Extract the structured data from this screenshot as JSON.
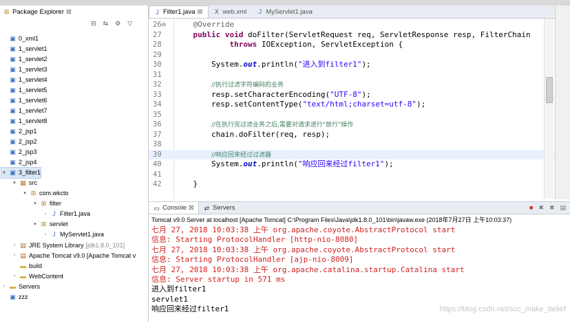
{
  "package_explorer": {
    "title": "Package Explorer",
    "close_glyph": "⊠",
    "tree": [
      {
        "label": "0_xml1",
        "icon": "project-icon",
        "indent": 0,
        "toggle": ""
      },
      {
        "label": "1_servlet1",
        "icon": "project-icon",
        "indent": 0,
        "toggle": ""
      },
      {
        "label": "1_servlet2",
        "icon": "project-icon",
        "indent": 0,
        "toggle": ""
      },
      {
        "label": "1_servlet3",
        "icon": "project-icon",
        "indent": 0,
        "toggle": ""
      },
      {
        "label": "1_servlet4",
        "icon": "project-icon",
        "indent": 0,
        "toggle": ""
      },
      {
        "label": "1_servlet5",
        "icon": "project-icon",
        "indent": 0,
        "toggle": ""
      },
      {
        "label": "1_servlet6",
        "icon": "project-icon",
        "indent": 0,
        "toggle": ""
      },
      {
        "label": "1_servlet7",
        "icon": "project-icon",
        "indent": 0,
        "toggle": ""
      },
      {
        "label": "1_servlet8",
        "icon": "project-icon",
        "indent": 0,
        "toggle": ""
      },
      {
        "label": "2_jsp1",
        "icon": "project-icon",
        "indent": 0,
        "toggle": ""
      },
      {
        "label": "2_jsp2",
        "icon": "project-icon",
        "indent": 0,
        "toggle": ""
      },
      {
        "label": "2_jsp3",
        "icon": "project-icon",
        "indent": 0,
        "toggle": ""
      },
      {
        "label": "2_jsp4",
        "icon": "project-icon",
        "indent": 0,
        "toggle": ""
      },
      {
        "label": "3_filter1",
        "icon": "web-project-icon",
        "indent": 0,
        "toggle": "▾",
        "selected": true
      },
      {
        "label": "src",
        "icon": "source-folder-icon",
        "indent": 1,
        "toggle": "▾"
      },
      {
        "label": "com.wkcto",
        "icon": "package-icon",
        "indent": 2,
        "toggle": "▾"
      },
      {
        "label": "filter",
        "icon": "package-icon",
        "indent": 3,
        "toggle": "▾"
      },
      {
        "label": "Filter1.java",
        "icon": "java-file-icon",
        "indent": 4,
        "toggle": "›"
      },
      {
        "label": "servlet",
        "icon": "package-icon",
        "indent": 3,
        "toggle": "▾"
      },
      {
        "label": "MyServlet1.java",
        "icon": "java-file-icon",
        "indent": 4,
        "toggle": "›"
      },
      {
        "label": "JRE System Library",
        "suffix": "[jdk1.8.0_101]",
        "icon": "library-icon",
        "indent": 1,
        "toggle": "›"
      },
      {
        "label": "Apache Tomcat v9.0 [Apache Tomcat v",
        "icon": "library-icon",
        "indent": 1,
        "toggle": "›"
      },
      {
        "label": "build",
        "icon": "folder-icon",
        "indent": 1,
        "toggle": ""
      },
      {
        "label": "WebContent",
        "icon": "folder-icon",
        "indent": 1,
        "toggle": "›"
      },
      {
        "label": "Servers",
        "icon": "folder-icon",
        "indent": 0,
        "toggle": "›"
      },
      {
        "label": "zzz",
        "icon": "project-icon",
        "indent": 0,
        "toggle": ""
      }
    ]
  },
  "editor": {
    "tabs": [
      {
        "label": "Filter1.java",
        "active": true,
        "close": "⊠",
        "icon": "java-file-icon"
      },
      {
        "label": "web.xml",
        "active": false,
        "close": "",
        "icon": "xml-file-icon"
      },
      {
        "label": "MyServlet1.java",
        "active": false,
        "close": "",
        "icon": "java-file-icon"
      }
    ],
    "lines": [
      {
        "n": "26",
        "marker": "⊖",
        "tokens": [
          {
            "t": "    "
          },
          {
            "t": "@Override",
            "c": "ann"
          }
        ]
      },
      {
        "n": "27",
        "marker": "",
        "tokens": [
          {
            "t": "    "
          },
          {
            "t": "public",
            "c": "kw"
          },
          {
            "t": " "
          },
          {
            "t": "void",
            "c": "kw"
          },
          {
            "t": " doFilter(ServletRequest req, ServletResponse resp, FilterChain"
          }
        ]
      },
      {
        "n": "28",
        "marker": "",
        "tokens": [
          {
            "t": "            "
          },
          {
            "t": "throws",
            "c": "kw"
          },
          {
            "t": " IOException, ServletException {"
          }
        ]
      },
      {
        "n": "29",
        "marker": "",
        "tokens": []
      },
      {
        "n": "30",
        "marker": "",
        "tokens": [
          {
            "t": "        System."
          },
          {
            "t": "out",
            "c": "fld"
          },
          {
            "t": ".println("
          },
          {
            "t": "\"进入到filter1\"",
            "c": "str"
          },
          {
            "t": ");"
          }
        ]
      },
      {
        "n": "31",
        "marker": "",
        "tokens": []
      },
      {
        "n": "32",
        "marker": "",
        "tokens": [
          {
            "t": "        "
          },
          {
            "t": "//执行过滤字符编码的业务",
            "c": "cm"
          }
        ]
      },
      {
        "n": "33",
        "marker": "",
        "tokens": [
          {
            "t": "        resp.setCharacterEncoding("
          },
          {
            "t": "\"UTF-8\"",
            "c": "str"
          },
          {
            "t": ");"
          }
        ]
      },
      {
        "n": "34",
        "marker": "",
        "tokens": [
          {
            "t": "        resp.setContentType("
          },
          {
            "t": "\"text/html;charset=utf-8\"",
            "c": "str"
          },
          {
            "t": ");"
          }
        ]
      },
      {
        "n": "35",
        "marker": "",
        "tokens": []
      },
      {
        "n": "36",
        "marker": "",
        "tokens": [
          {
            "t": "        "
          },
          {
            "t": "//在执行完过滤业务之后,需要对请求进行\"放行\"操作",
            "c": "cm"
          }
        ]
      },
      {
        "n": "37",
        "marker": "",
        "tokens": [
          {
            "t": "        chain.doFilter(req, resp);"
          }
        ]
      },
      {
        "n": "38",
        "marker": "",
        "tokens": []
      },
      {
        "n": "39",
        "marker": "",
        "highlight": true,
        "tokens": [
          {
            "t": "        "
          },
          {
            "t": "//响应回来经过过滤器",
            "c": "cm"
          }
        ]
      },
      {
        "n": "40",
        "marker": "",
        "tokens": [
          {
            "t": "        System."
          },
          {
            "t": "out",
            "c": "fld"
          },
          {
            "t": ".println("
          },
          {
            "t": "\"响应回来经过filter1\"",
            "c": "str"
          },
          {
            "t": ");"
          }
        ]
      },
      {
        "n": "41",
        "marker": "",
        "tokens": []
      },
      {
        "n": "42",
        "marker": "",
        "tokens": [
          {
            "t": "    }"
          }
        ]
      }
    ]
  },
  "console": {
    "tabs": [
      {
        "label": "Console",
        "active": true,
        "close": "⊠",
        "icon": "console-icon"
      },
      {
        "label": "Servers",
        "active": false,
        "close": "",
        "icon": "servers-icon"
      }
    ],
    "header": "Tomcat v9.0 Server at localhost [Apache Tomcat] C:\\Program Files\\Java\\jdk1.8.0_101\\bin\\javaw.exe (2018年7月27日 上午10:03:37)",
    "lines": [
      {
        "text": "七月 27, 2018 10:03:38 上午 org.apache.coyote.AbstractProtocol start",
        "c": "red"
      },
      {
        "text": "信息: Starting ProtocolHandler [http-nio-8080]",
        "c": "red"
      },
      {
        "text": "七月 27, 2018 10:03:38 上午 org.apache.coyote.AbstractProtocol start",
        "c": "red"
      },
      {
        "text": "信息: Starting ProtocolHandler [ajp-nio-8009]",
        "c": "red"
      },
      {
        "text": "七月 27, 2018 10:03:38 上午 org.apache.catalina.startup.Catalina start",
        "c": "red"
      },
      {
        "text": "信息: Server startup in 571 ms",
        "c": "red"
      },
      {
        "text": "进入到filter1",
        "c": "blk"
      },
      {
        "text": "servlet1",
        "c": "blk"
      },
      {
        "text": "响应回来经过filter1",
        "c": "blk"
      }
    ],
    "watermark": "https://blog.csdn.net/scc_make_belief"
  },
  "colors": {
    "error_text": "#d21f1f",
    "keyword": "#7f0055",
    "string": "#2a00ff",
    "comment": "#3f7f5f",
    "selection": "#d8e6f6"
  }
}
